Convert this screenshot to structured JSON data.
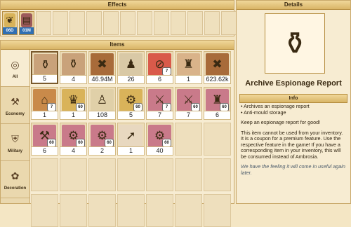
{
  "effects": {
    "title": "Effects",
    "slots": [
      {
        "icon": "scroll-icon",
        "label": "06D",
        "bg": "#d8b35a"
      },
      {
        "icon": "document-icon",
        "label": "01M",
        "bg": "#9c5a5a"
      },
      {},
      {},
      {},
      {},
      {},
      {},
      {},
      {},
      {},
      {},
      {},
      {}
    ]
  },
  "items": {
    "title": "Items",
    "categories": [
      {
        "name": "all",
        "label": "All",
        "icon": "globe-icon",
        "glyph": "◎",
        "active": true
      },
      {
        "name": "economy",
        "label": "Economy",
        "icon": "hammer-pick-icon",
        "glyph": "⚒",
        "active": false
      },
      {
        "name": "military",
        "label": "Military",
        "icon": "helmet-icon",
        "glyph": "⛨",
        "active": false
      },
      {
        "name": "decoration",
        "label": "Decoration",
        "icon": "flower-icon",
        "glyph": "✿",
        "active": false
      }
    ],
    "grid": [
      {
        "icon": "archive-espionage-icon",
        "glyph": "⚱",
        "bg": "#c9a27a",
        "count": "5",
        "selected": true
      },
      {
        "icon": "archive-icon",
        "glyph": "⚱",
        "bg": "#c9a27a",
        "count": "4"
      },
      {
        "icon": "crate-icon",
        "glyph": "✖",
        "bg": "#a86b3a",
        "count": "46.94M"
      },
      {
        "icon": "workers-icon",
        "glyph": "♟",
        "bg": "#d9c9a6",
        "count": "26"
      },
      {
        "icon": "no-entry-icon",
        "glyph": "⊘",
        "bg": "#d95a4a",
        "count": "6",
        "badge": "7"
      },
      {
        "icon": "tower-icon",
        "glyph": "♜",
        "bg": "#d9b38a",
        "count": "1"
      },
      {
        "icon": "crate-icon",
        "glyph": "✖",
        "bg": "#a86b3a",
        "count": "623.62k"
      },
      {
        "icon": "workshop-icon",
        "glyph": "⌂",
        "bg": "#c98a4a",
        "count": "1",
        "badge": "7"
      },
      {
        "icon": "statue-icon",
        "glyph": "♛",
        "bg": "#d9b35a",
        "count": "1",
        "badge": "60"
      },
      {
        "icon": "merchant-icon",
        "glyph": "♙",
        "bg": "#e0d0a8",
        "count": "108"
      },
      {
        "icon": "catapult-icon",
        "glyph": "⚙",
        "bg": "#d9b35a",
        "count": "5",
        "badge": "60"
      },
      {
        "icon": "trebuchet-icon",
        "glyph": "⚔",
        "bg": "#c97a8a",
        "count": "7",
        "badge": "7"
      },
      {
        "icon": "ballista-icon",
        "glyph": "⚔",
        "bg": "#c97a8a",
        "count": "7",
        "badge": "60"
      },
      {
        "icon": "siege-tower-icon",
        "glyph": "♜",
        "bg": "#c97a8a",
        "count": "6",
        "badge": "60"
      },
      {
        "icon": "ram-icon",
        "glyph": "⚒",
        "bg": "#c97a8a",
        "count": "6",
        "badge": "60"
      },
      {
        "icon": "siege-engine-icon",
        "glyph": "⚙",
        "bg": "#c97a8a",
        "count": "4",
        "badge": "60"
      },
      {
        "icon": "cannon-icon",
        "glyph": "⚙",
        "bg": "#c97a8a",
        "count": "2",
        "badge": "60"
      },
      {
        "icon": "upgrade-arrow-icon",
        "glyph": "➚",
        "bg": "#e8d8c0",
        "count": "1"
      },
      {
        "icon": "cannon-icon",
        "glyph": "⚙",
        "bg": "#c97a8a",
        "count": "40",
        "badge": "60"
      },
      {},
      {},
      {},
      {},
      {},
      {},
      {},
      {},
      {},
      {},
      {},
      {},
      {},
      {},
      {},
      {}
    ]
  },
  "details": {
    "title": "Details",
    "item_name": "Archive Espionage Report",
    "info_title": "Info",
    "bullets": [
      "• Archives an espionage report",
      "• Anti-mould storage"
    ],
    "para1": "Keep an espionage report for good!",
    "para2": "This item cannot be used from your inventory. It is a coupon for a premium feature. Use the respective feature in the game! If you have a corresponding item in your inventory, this will be consumed instead of Ambrosia.",
    "para3": "We have the feeling it will come in useful again later."
  }
}
